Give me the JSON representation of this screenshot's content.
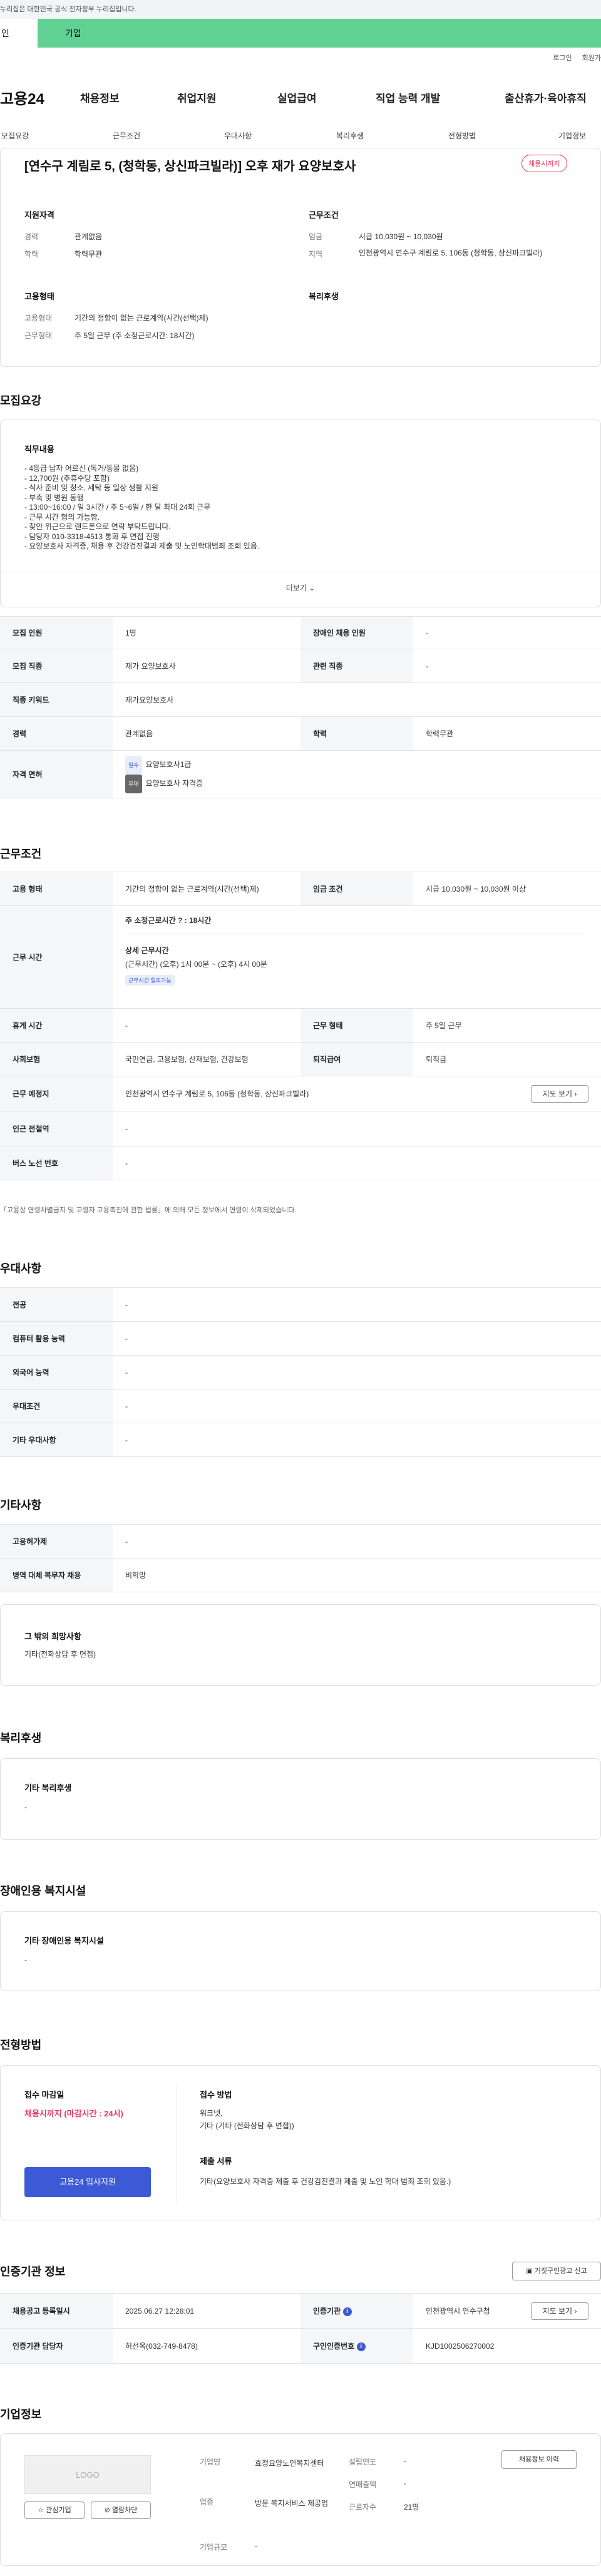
{
  "gov_banner": "누리집은 대한민국 공식 전자정부 누리집입니다.",
  "tabs": {
    "personal": "인",
    "company": "기업"
  },
  "util": {
    "login": "로그인",
    "join": "회원가"
  },
  "gnb": {
    "logo": "고용24",
    "menus": [
      "채용정보",
      "취업지원",
      "실업급여",
      "직업 능력 개발",
      "출산휴가·육아휴직"
    ]
  },
  "anchors": [
    "모집요강",
    "근무조건",
    "우대사항",
    "복리후생",
    "전형방법",
    "기업정보"
  ],
  "job": {
    "title": "[연수구 계림로 5, (청학동, 상신파크빌라)] 오후 재가 요양보호사",
    "badge": "채용시까지",
    "qual_title": "지원자격",
    "cond_title": "근무조건",
    "career_label": "경력",
    "career": "관계없음",
    "edu_label": "학력",
    "edu": "학력무관",
    "wage_label": "임금",
    "wage": "시급 10,030원 ~ 10,030원",
    "region_label": "지역",
    "region": "인천광역시 연수구 계림로 5, 106동 (청학동, 상신파크빌라)",
    "emp_title": "고용형태",
    "welfare_title": "복리후생",
    "emptype_label": "고용형태",
    "emptype": "기간의 정함이 없는 근로계약(시간(선택)제)",
    "worktype_label": "근무형태",
    "worktype": "주 5일 근무 (주 소정근로시간: 18시간)"
  },
  "recruit": {
    "section": "모집요강",
    "duty_title": "직무내용",
    "duty_lines": [
      "- 4등급 남자 어르신 (독거/동물 없음)",
      "- 12,700원 (주휴수당 포함)",
      "- 식사 준비 및 청소, 세탁 등 일상 생활 지원",
      "- 부축 및 병원 동행",
      "- 13:00~16:00 / 일 3시간 / 주 5~6일 / 한 달 최대 24회 근무",
      "- 근무 시간 협의 가능함.",
      "- 찾안 위근으로 랜드폰으로 연락 부탁드립니다.",
      "- 담당자 010-3318-4513 통화 후 면접 진행",
      "- 요양보호사 자격증, 채용 후 건강검진결과 제출 및 노인학대범죄 조회 있음."
    ],
    "more": "더보기",
    "rows": {
      "count_h": "모집 인원",
      "count": "1명",
      "disabled_h": "장애인 채용 인원",
      "disabled": "-",
      "job_h": "모집 직종",
      "job": "재가 요양보호사",
      "rel_h": "관련 직종",
      "rel": "-",
      "kw_h": "직종 키워드",
      "kw": "재가요양보호사",
      "career_h": "경력",
      "career": "관계없음",
      "edu_h": "학력",
      "edu": "학력무관",
      "lic_h": "자격 면허",
      "lic1_chip": "필수",
      "lic1": "요양보호사1급",
      "lic2_chip": "우대",
      "lic2": "요양보호사 자격증"
    }
  },
  "cond": {
    "section": "근무조건",
    "emp_h": "고용 형태",
    "emp": "기간의 정함이 없는 근로계약(시간(선택)제)",
    "wage_h": "임금 조건",
    "wage": "시급 10,030원 ~ 10,030원 이상",
    "time_h": "근무 시간",
    "weekly": "주 소정근로시간 ? : 18시간",
    "detail_title": "상세 근무시간",
    "detail": "(근무시간) (오후) 1시 00분 ~ (오후) 4시 00분",
    "detail_chip": "근무시간 협의가능",
    "rest_h": "휴게 시간",
    "rest": "-",
    "form_h": "근무 형태",
    "form": "주 5일 근무",
    "ins_h": "사회보험",
    "ins": "국민연금, 고용보험, 산재보험, 건강보험",
    "sev_h": "퇴직급여",
    "sev": "퇴직금",
    "loc_h": "근무 예정지",
    "loc": "인천광역시 연수구 계림로 5, 106동 (청학동, 상신파크빌라)",
    "map_btn": "지도 보기",
    "subway_h": "인근 전철역",
    "subway": "-",
    "bus_h": "버스 노선 번호",
    "bus": "-",
    "note": "「고용상 연령차별금지 및 고령자 고용촉진에 관한 법률」에 의해 모든 정보에서 연령이 삭제되었습니다."
  },
  "pref": {
    "section": "우대사항",
    "rows": [
      {
        "h": "전공",
        "v": "-"
      },
      {
        "h": "컴퓨터 활용 능력",
        "v": "-"
      },
      {
        "h": "외국어 능력",
        "v": "-"
      },
      {
        "h": "우대조건",
        "v": "-"
      },
      {
        "h": "기타 우대사항",
        "v": "-"
      }
    ]
  },
  "etc": {
    "section": "기타사항",
    "rows": [
      {
        "h": "고용허가제",
        "v": "-"
      },
      {
        "h": "병역 대체 복무자 채용",
        "v": "비희망"
      }
    ],
    "other_title": "그 밖의 희망사항",
    "other": "기타(전화상담 후 면접)"
  },
  "welfare": {
    "section": "복리후생",
    "title": "기타 복리후생",
    "value": "-"
  },
  "disabled": {
    "section": "장애인용 복지시설",
    "title": "기타 장애인용 복지시설",
    "value": "-"
  },
  "screen": {
    "section": "전형방법",
    "deadline_title": "접수 마감일",
    "deadline": "채용시까지 (마감시간 : 24시)",
    "apply_btn": "고용24 입사지원",
    "method_title": "접수 방법",
    "method": "워크넷,\n기타 (기타 (전화상담 후 면접))",
    "docs_title": "제출 서류",
    "docs": "기타(요양보호사 자격증 제출 후 건강검진결과 제출 및 노인 학대 범죄 조회 있음.)"
  },
  "cert": {
    "section": "인증기관 정보",
    "report_btn": "거짓구인광고 신고",
    "reg_h": "채용공고 등록일시",
    "reg": "2025.06.27 12:28:01",
    "org_h": "인증기관",
    "org": "인천광역시 연수구청",
    "map_btn": "지도 보기",
    "mgr_h": "인증기관 담당자",
    "mgr": "허선옥(032-749-8478)",
    "num_h": "구인인증번호",
    "num": "KJD1002506270002"
  },
  "company": {
    "section": "기업정보",
    "logo": "LOGO",
    "fav_btn": "관심기업",
    "block_btn": "열람차단",
    "info_btn": "채용정보 이력",
    "name_h": "기업명",
    "name": "효정요양노인복지센터",
    "ind_h": "업종",
    "ind": "방문 복지서비스 제공업",
    "scale_h": "기업규모",
    "scale": "-",
    "est_h": "설립연도",
    "est": "-",
    "sales_h": "연매출액",
    "sales": "-",
    "emp_h": "근로자수",
    "emp": "21명"
  }
}
